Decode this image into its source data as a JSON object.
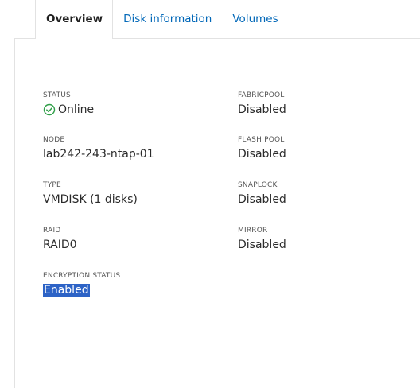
{
  "tabs": [
    {
      "label": "Overview",
      "active": true
    },
    {
      "label": "Disk information",
      "active": false
    },
    {
      "label": "Volumes",
      "active": false
    }
  ],
  "overview": {
    "status": {
      "label": "STATUS",
      "value": "Online",
      "icon": "check-circle-icon",
      "color": "#2e9e47"
    },
    "node": {
      "label": "NODE",
      "value": "lab242-243-ntap-01"
    },
    "type": {
      "label": "TYPE",
      "value": "VMDISK (1 disks)"
    },
    "raid": {
      "label": "RAID",
      "value": "RAID0"
    },
    "encryption_status": {
      "label": "ENCRYPTION STATUS",
      "value": "Enabled",
      "selected": true
    },
    "fabricpool": {
      "label": "FABRICPOOL",
      "value": "Disabled"
    },
    "flash_pool": {
      "label": "FLASH POOL",
      "value": "Disabled"
    },
    "snaplock": {
      "label": "SNAPLOCK",
      "value": "Disabled"
    },
    "mirror": {
      "label": "MIRROR",
      "value": "Disabled"
    }
  },
  "colors": {
    "link": "#0067b8",
    "selection": "#2d63c6",
    "border": "#e2e2e2"
  }
}
